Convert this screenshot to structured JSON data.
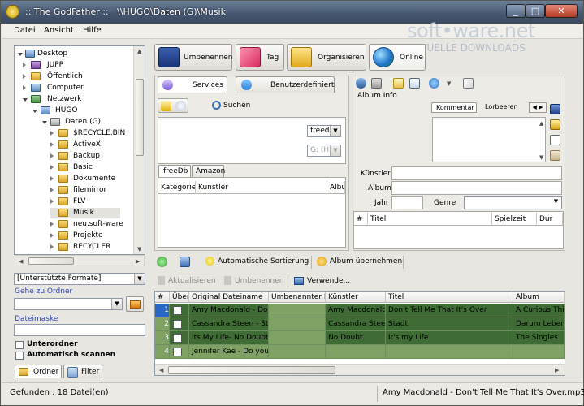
{
  "window": {
    "title": ":: The GodFather ::   \\\\HUGO\\Daten (G)\\Musik",
    "minimize": "_",
    "maximize": "□",
    "close": "✕"
  },
  "menu": [
    "Datei",
    "Ansicht",
    "Hilfe"
  ],
  "watermark": {
    "line1": "soft•ware.net",
    "line2": "AKTUELLE DOWNLOADS"
  },
  "tree": [
    {
      "label": "Desktop"
    },
    {
      "label": "JUPP"
    },
    {
      "label": "Öffentlich"
    },
    {
      "label": "Computer"
    },
    {
      "label": "Netzwerk"
    },
    {
      "label": "HUGO"
    },
    {
      "label": "Daten (G)"
    },
    {
      "label": "$RECYCLE.BIN"
    },
    {
      "label": "ActiveX"
    },
    {
      "label": "Backup"
    },
    {
      "label": "Basic"
    },
    {
      "label": "Dokumente"
    },
    {
      "label": "filemirror"
    },
    {
      "label": "FLV"
    },
    {
      "label": "Musik"
    },
    {
      "label": "neu.soft-ware"
    },
    {
      "label": "Projekte"
    },
    {
      "label": "RECYCLER"
    }
  ],
  "left": {
    "format": "[Unterstützte Formate]",
    "goto": "Gehe zu Ordner",
    "filemask": "Dateimaske",
    "subfolders": "Unterordner",
    "autoscan": "Automatisch scannen",
    "tab_folder": "Ordner",
    "tab_filter": "Filter"
  },
  "toolbar": {
    "rename": "Umbenennen",
    "tag": "Tag",
    "organize": "Organisieren",
    "online": "Online"
  },
  "services": {
    "tab_services": "Services",
    "tab_custom": "Benutzerdefiniert",
    "search": "Suchen",
    "source": "freedb",
    "drive": "G: (H",
    "tab_freedb": "freeDb",
    "tab_amazon": "Amazon",
    "cols": [
      "Kategorie",
      "Künstler",
      "Album"
    ]
  },
  "album": {
    "title": "Album Info",
    "tab_comment": "Kommentar",
    "tab_laurels": "Lorbeeren",
    "artist": "Künstler",
    "album": "Album",
    "year": "Jahr",
    "genre": "Genre",
    "cols": [
      "#",
      "Titel",
      "Spielzeit",
      "Dur"
    ]
  },
  "lower": {
    "autosort": "Automatische Sortierung",
    "apply_album": "Album übernehmen",
    "refresh": "Aktualisieren",
    "rename": "Umbenennen",
    "use": "Verwende...",
    "cols": [
      "#",
      "Über",
      "Original Dateiname",
      "Umbenannter D",
      "Künstler",
      "Titel",
      "Album"
    ],
    "rows": [
      {
        "n": "1",
        "file": "Amy Macdonald - Don",
        "renamed": "",
        "artist": "Amy Macdonald",
        "title": "Don't Tell Me That It's Over",
        "album": "A Curious Thing"
      },
      {
        "n": "2",
        "file": "Cassandra Steen - Sta",
        "renamed": "",
        "artist": "Cassandra Steen",
        "title": "Stadt",
        "album": "Darum Leben"
      },
      {
        "n": "3",
        "file": "Its My Life- No Doubt.",
        "renamed": "",
        "artist": "No Doubt",
        "title": "It's my Life",
        "album": "The Singles"
      },
      {
        "n": "4",
        "file": "Jennifer Kae - Do you",
        "renamed": "",
        "artist": "",
        "title": "",
        "album": ""
      }
    ]
  },
  "status": {
    "found": "Gefunden : 18 Datei(en)",
    "current": "Amy Macdonald - Don't Tell Me That It's Over.mp3"
  },
  "colors": {
    "row_dark": "#3f6b34",
    "row_light": "#7fa163",
    "selected": "#2a66c8"
  }
}
